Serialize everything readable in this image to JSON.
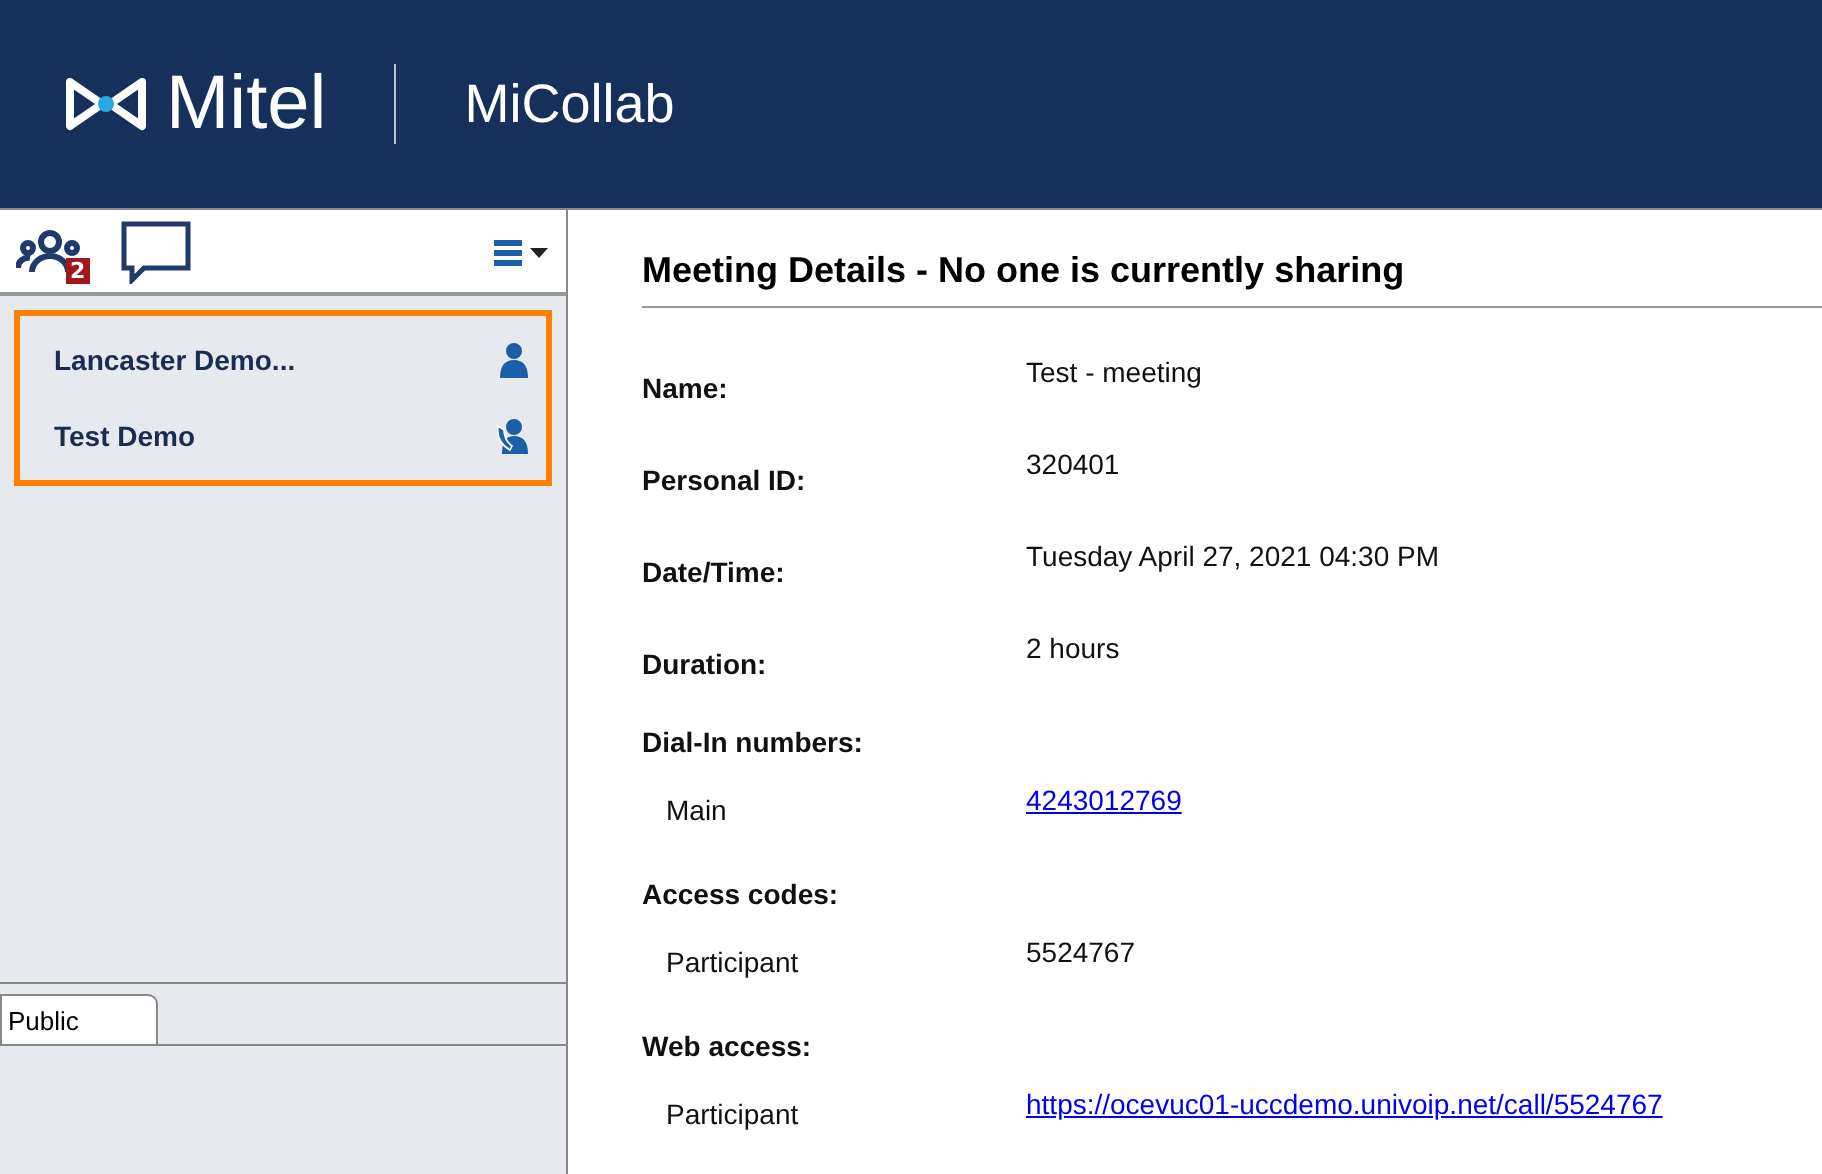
{
  "header": {
    "brand": "Mitel",
    "product": "MiCollab"
  },
  "toolbar": {
    "participants_badge": "2"
  },
  "meetings": [
    {
      "name": "Lancaster Demo...",
      "kind": "person"
    },
    {
      "name": "Test Demo",
      "kind": "phone"
    }
  ],
  "tabs": [
    {
      "label": "Public",
      "selected": true
    }
  ],
  "details": {
    "title": "Meeting Details - No one is currently sharing",
    "rows": [
      {
        "kind": "field",
        "label": "Name:",
        "value": "Test - meeting"
      },
      {
        "kind": "field",
        "label": "Personal ID:",
        "value": "320401"
      },
      {
        "kind": "field",
        "label": "Date/Time:",
        "value": "Tuesday April 27, 2021 04:30 PM"
      },
      {
        "kind": "field",
        "label": "Duration:",
        "value": "2 hours"
      },
      {
        "kind": "section",
        "label": "Dial-In numbers:"
      },
      {
        "kind": "sub",
        "label": "Main",
        "value": "4243012769",
        "link": true
      },
      {
        "kind": "section",
        "label": "Access codes:"
      },
      {
        "kind": "sub",
        "label": "Participant",
        "value": "5524767",
        "link": false
      },
      {
        "kind": "section",
        "label": "Web access:"
      },
      {
        "kind": "sub",
        "label": "Participant",
        "value": "https://ocevuc01-uccdemo.univoip.net/call/5524767",
        "link": true
      }
    ]
  }
}
